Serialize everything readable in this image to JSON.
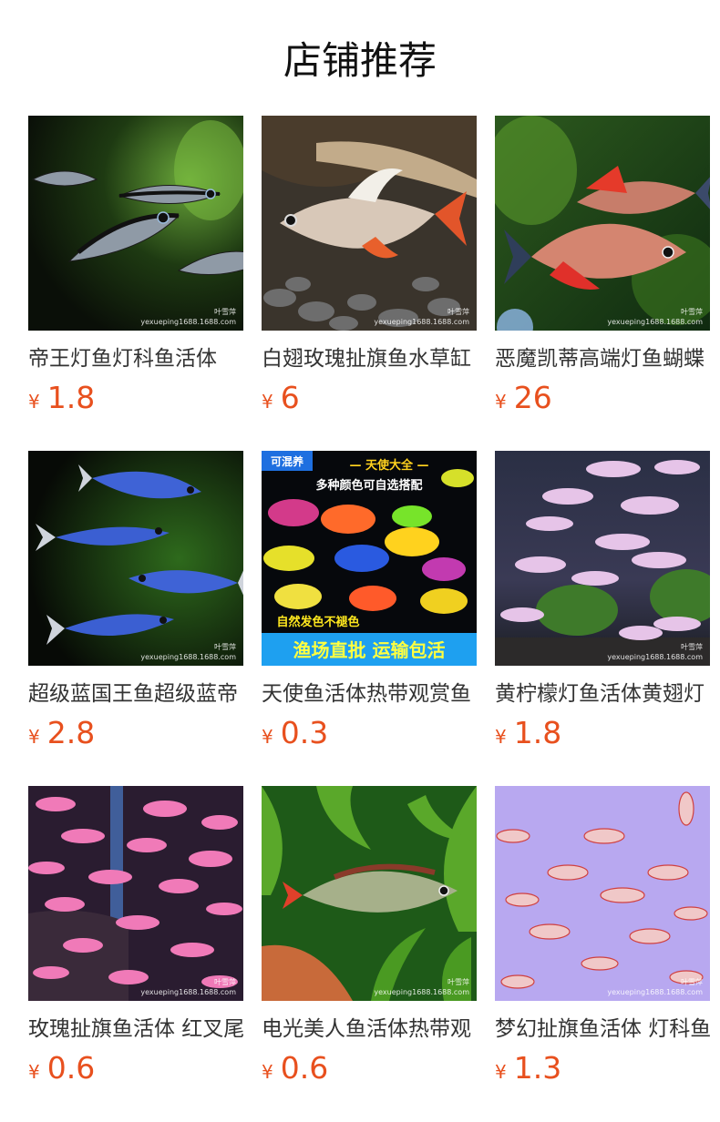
{
  "section": {
    "title": "店铺推荐"
  },
  "watermark": {
    "name": "叶雪萍",
    "site": "yexueping1688.1688.com"
  },
  "products": [
    {
      "title": "帝王灯鱼灯科鱼活体",
      "currency": "¥",
      "price": "1.8",
      "image": "emperor-tetra-photo"
    },
    {
      "title": "白翅玫瑰扯旗鱼水草缸",
      "currency": "¥",
      "price": "6",
      "image": "white-fin-rosy-tetra-photo"
    },
    {
      "title": "恶魔凯蒂高端灯鱼蝴蝶",
      "currency": "¥",
      "price": "26",
      "image": "devil-tetra-photo"
    },
    {
      "title": "超级蓝国王鱼超级蓝帝",
      "currency": "¥",
      "price": "2.8",
      "image": "super-blue-emperor-photo"
    },
    {
      "title": "天使鱼活体热带观赏鱼",
      "currency": "¥",
      "price": "0.3",
      "image": "glofish-tetra-photo",
      "overlay": {
        "badge": "可混养",
        "headline": "— 天使大全 —",
        "subline": "多种颜色可自选搭配",
        "caption": "自然发色不褪色",
        "banner": "渔场直批 运输包活"
      }
    },
    {
      "title": "黄柠檬灯鱼活体黄翅灯",
      "currency": "¥",
      "price": "1.8",
      "image": "lemon-tetra-photo"
    },
    {
      "title": "玫瑰扯旗鱼活体 红叉尾",
      "currency": "¥",
      "price": "0.6",
      "image": "rosy-tetra-school-photo"
    },
    {
      "title": "电光美人鱼活体热带观",
      "currency": "¥",
      "price": "0.6",
      "image": "rainbowfish-photo"
    },
    {
      "title": "梦幻扯旗鱼活体 灯科鱼",
      "currency": "¥",
      "price": "1.3",
      "image": "fantasy-tetra-photo"
    }
  ]
}
